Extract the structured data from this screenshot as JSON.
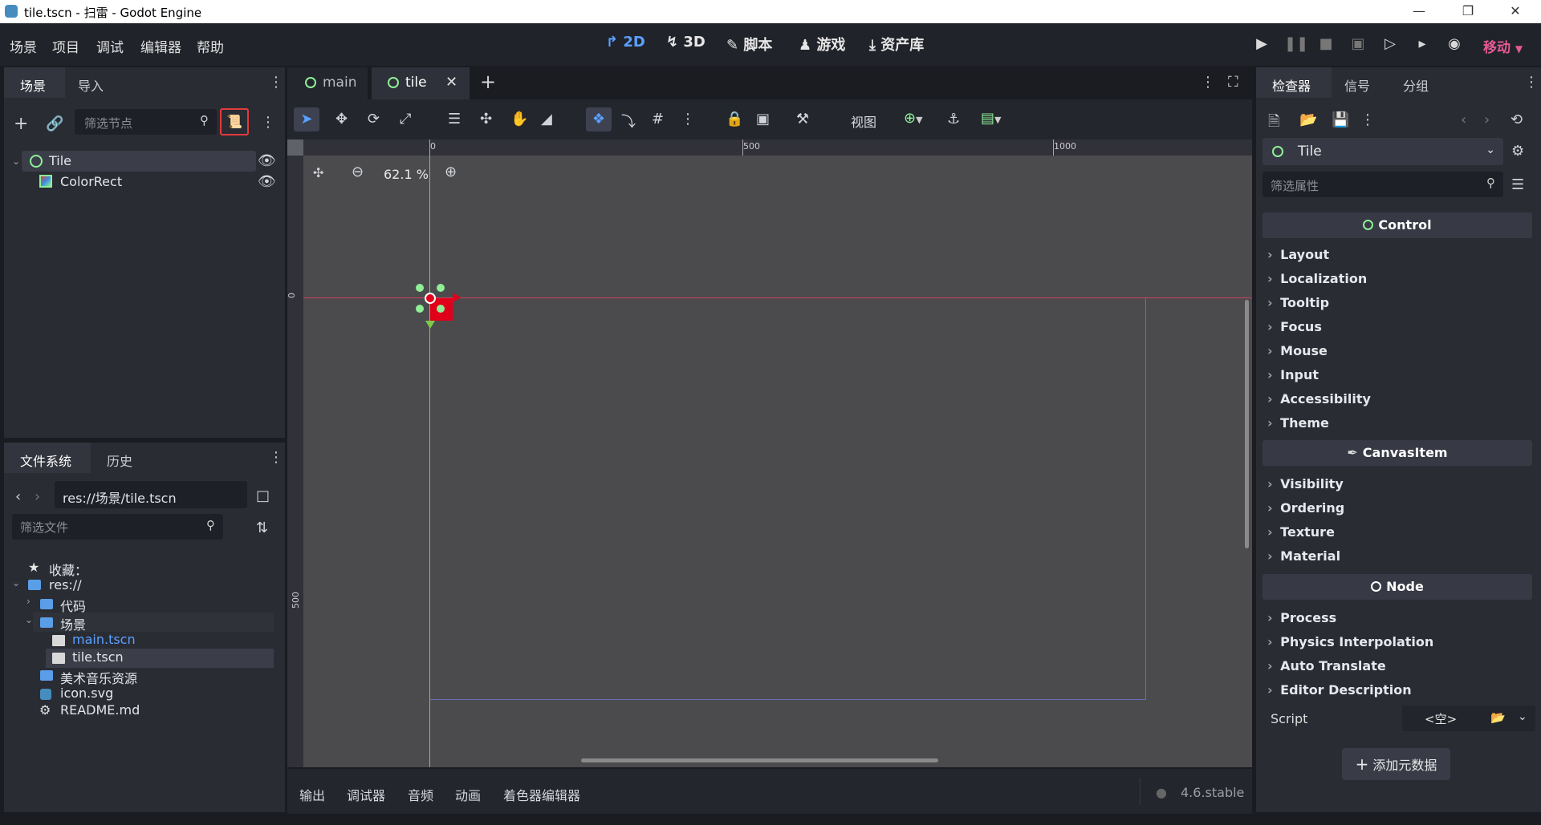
{
  "window": {
    "title": "tile.tscn - 扫雷 - Godot Engine"
  },
  "menu": [
    "场景",
    "项目",
    "调试",
    "编辑器",
    "帮助"
  ],
  "workspaces": [
    {
      "label": "2D",
      "icon": "2d-icon",
      "active": true
    },
    {
      "label": "3D",
      "icon": "3d-icon",
      "active": false
    },
    {
      "label": "脚本",
      "icon": "script-icon",
      "active": false
    },
    {
      "label": "游戏",
      "icon": "game-icon",
      "active": false
    },
    {
      "label": "资产库",
      "icon": "assetlib-icon",
      "active": false
    }
  ],
  "renderer": "移动",
  "scene_dock": {
    "tabs": [
      "场景",
      "导入"
    ],
    "filter_placeholder": "筛选节点",
    "nodes": [
      {
        "name": "Tile",
        "type": "control"
      },
      {
        "name": "ColorRect",
        "type": "colorrect"
      }
    ]
  },
  "editor_tabs": [
    {
      "label": "main",
      "active": false
    },
    {
      "label": "tile",
      "active": true
    }
  ],
  "toolbar": {
    "view_label": "视图"
  },
  "viewport": {
    "zoom": "62.1 %",
    "ruler_h": [
      "0",
      "500",
      "1000"
    ],
    "ruler_v": [
      "0",
      "500"
    ]
  },
  "filesystem": {
    "tabs": [
      "文件系统",
      "历史"
    ],
    "path": "res://场景/tile.tscn",
    "filter_placeholder": "筛选文件",
    "items": [
      {
        "label": "收藏："
      },
      {
        "label": "res://"
      },
      {
        "label": "代码"
      },
      {
        "label": "场景"
      },
      {
        "label": "main.tscn"
      },
      {
        "label": "tile.tscn"
      },
      {
        "label": "美术音乐资源"
      },
      {
        "label": "icon.svg"
      },
      {
        "label": "README.md"
      }
    ]
  },
  "inspector": {
    "tabs": [
      "检查器",
      "信号",
      "分组"
    ],
    "node_name": "Tile",
    "filter_placeholder": "筛选属性",
    "sections": {
      "control": "Control",
      "control_props": [
        "Layout",
        "Localization",
        "Tooltip",
        "Focus",
        "Mouse",
        "Input",
        "Accessibility",
        "Theme"
      ],
      "canvasitem": "CanvasItem",
      "canvasitem_props": [
        "Visibility",
        "Ordering",
        "Texture",
        "Material"
      ],
      "node": "Node",
      "node_props": [
        "Process",
        "Physics Interpolation",
        "Auto Translate",
        "Editor Description"
      ]
    },
    "script_label": "Script",
    "script_value": "<空>",
    "add_metadata": "添加元数据"
  },
  "bottom_panel": {
    "tabs": [
      "输出",
      "调试器",
      "音频",
      "动画",
      "着色器编辑器"
    ],
    "version": "4.6.stable"
  },
  "colors": {
    "accent": "#5aa0ff",
    "node_green": "#8eef97",
    "rect_red": "#e0001a",
    "renderer_pink": "#e45a95",
    "selected_highlight": "#e23b3b"
  }
}
